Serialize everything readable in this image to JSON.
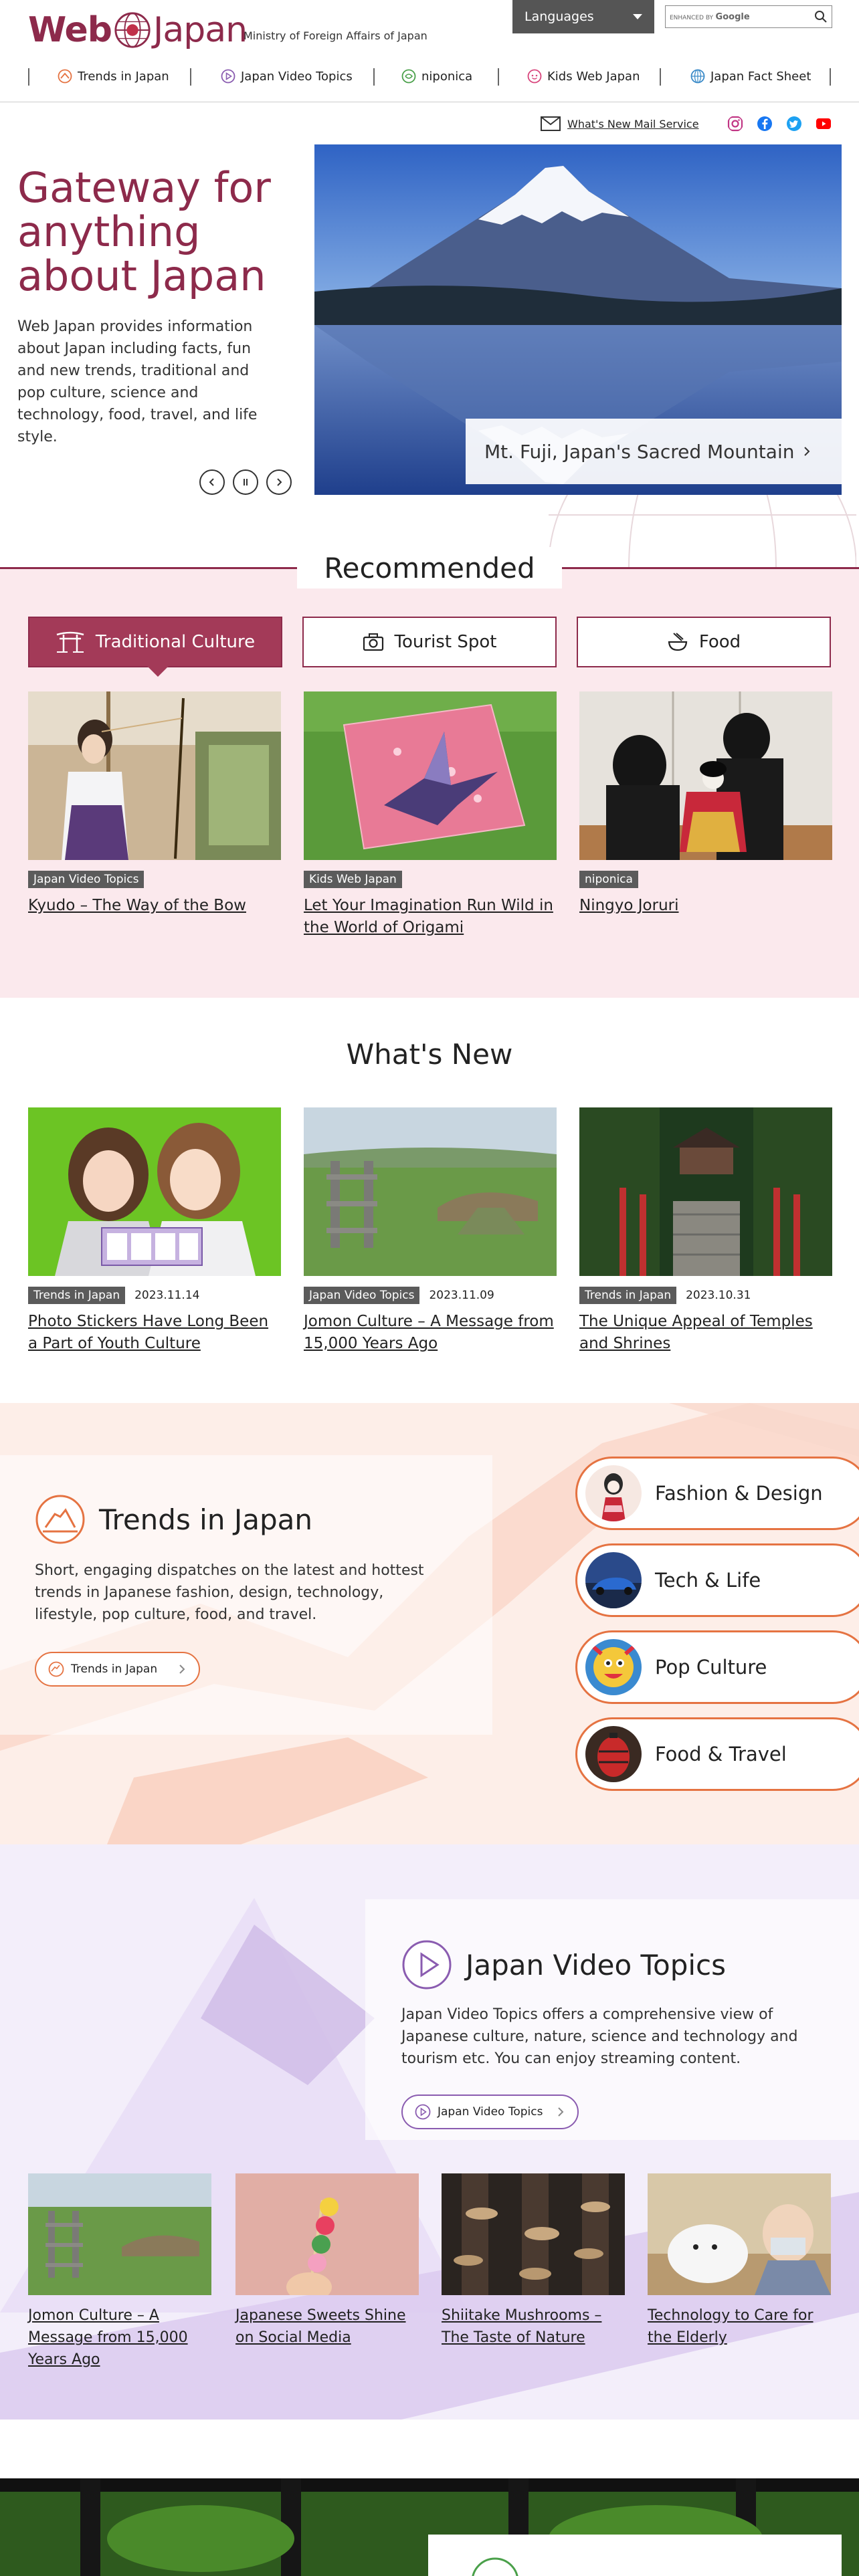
{
  "header": {
    "logo_web": "Web",
    "logo_japan": "Japan",
    "ministry": "Ministry of Foreign Affairs of Japan",
    "languages_label": "Languages",
    "search_enhanced": "ENHANCED BY",
    "search_google": "Google"
  },
  "nav": {
    "items": [
      {
        "label": "Trends in Japan",
        "icon": "trends-icon"
      },
      {
        "label": "Japan Video Topics",
        "icon": "video-topics-icon"
      },
      {
        "label": "niponica",
        "icon": "niponica-icon"
      },
      {
        "label": "Kids Web Japan",
        "icon": "kids-icon"
      },
      {
        "label": "Japan Fact Sheet",
        "icon": "fact-sheet-icon"
      }
    ]
  },
  "utility": {
    "mail_label": "What's New Mail Service",
    "social": [
      "instagram-icon",
      "facebook-icon",
      "twitter-icon",
      "youtube-icon"
    ]
  },
  "hero": {
    "title": "Gateway for anything about Japan",
    "description": "Web Japan provides information about Japan including facts, fun and new trends, traditional and pop culture, science and technology, food, travel, and life style.",
    "caption": "Mt. Fuji, Japan's Sacred Mountain"
  },
  "recommended": {
    "title": "Recommended",
    "tabs": [
      {
        "label": "Traditional Culture",
        "icon": "shrine-icon"
      },
      {
        "label": "Tourist Spot",
        "icon": "camera-icon"
      },
      {
        "label": "Food",
        "icon": "bowl-icon"
      }
    ],
    "cards": [
      {
        "badge": "Japan Video Topics",
        "title": "Kyudo – The Way of the Bow"
      },
      {
        "badge": "Kids Web Japan",
        "title": "Let Your Imagination Run Wild in the World of Origami"
      },
      {
        "badge": "niponica",
        "title": "Ningyo Joruri"
      }
    ]
  },
  "whats_new": {
    "title": "What's New",
    "cards": [
      {
        "badge": "Trends in Japan",
        "date": "2023.11.14",
        "title": "Photo Stickers Have Long Been a Part of Youth Culture"
      },
      {
        "badge": "Japan Video Topics",
        "date": "2023.11.09",
        "title": "Jomon Culture – A Message from 15,000 Years Ago"
      },
      {
        "badge": "Trends in Japan",
        "date": "2023.10.31",
        "title": "The Unique Appeal of Temples and Shrines"
      }
    ]
  },
  "trends": {
    "title": "Trends in Japan",
    "description": "Short, engaging dispatches on the latest and hottest trends in Japanese fashion, design, technology, lifestyle, pop culture, food, and travel.",
    "button": "Trends in Japan",
    "categories": [
      "Fashion & Design",
      "Tech & Life",
      "Pop Culture",
      "Food & Travel"
    ]
  },
  "video_topics": {
    "title": "Japan Video Topics",
    "description": "Japan Video Topics offers a comprehensive view of Japanese culture, nature, science and technology and tourism etc. You can enjoy streaming content.",
    "button": "Japan Video Topics",
    "cards": [
      {
        "title": "Jomon Culture – A Message from 15,000 Years Ago"
      },
      {
        "title": "Japanese Sweets Shine on Social Media"
      },
      {
        "title": "Shiitake Mushrooms – The Taste of Nature"
      },
      {
        "title": "Technology to Care for the Elderly"
      }
    ]
  },
  "colors": {
    "brand": "#8d2a4b",
    "accent_orange": "#e57342",
    "accent_purple": "#8a5cb0",
    "recommended_bg": "#fbe9ed"
  }
}
